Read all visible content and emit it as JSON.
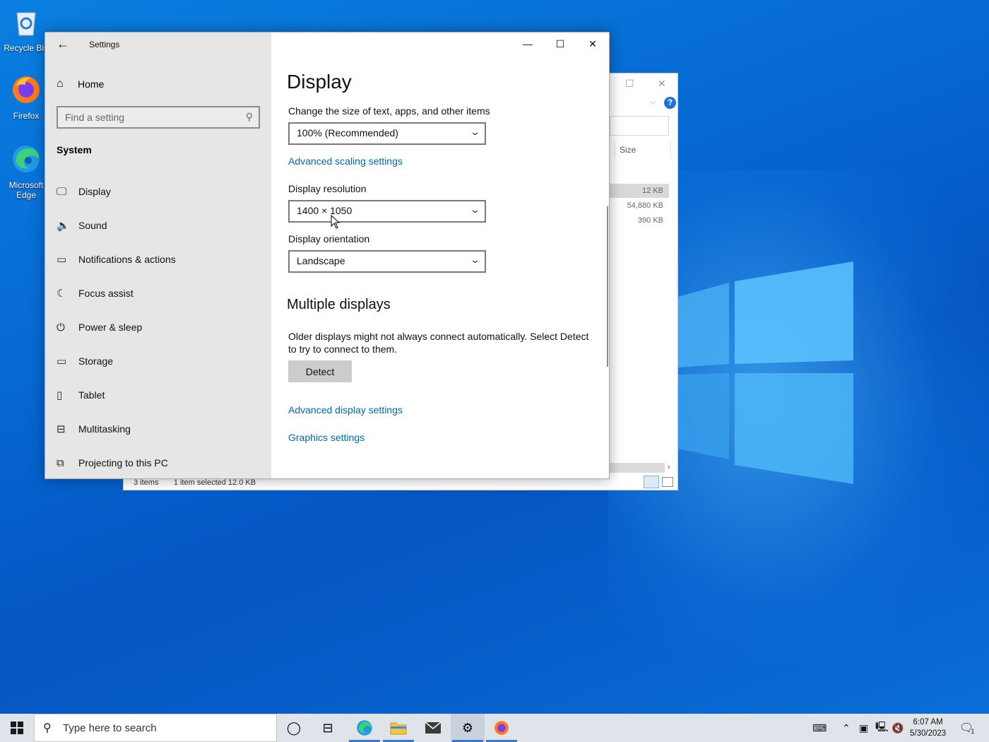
{
  "desktop": {
    "icons": [
      {
        "label": "Recycle Bin"
      },
      {
        "label": "Firefox"
      },
      {
        "label": "Microsoft Edge"
      }
    ]
  },
  "explorer": {
    "column_size": "Size",
    "rows": [
      "12 KB",
      "54,880 KB",
      "390 KB"
    ],
    "status_items": "3 items",
    "status_selected": "1 item selected  12.0 KB",
    "help": "?"
  },
  "settings": {
    "title": "Settings",
    "home_label": "Home",
    "search_placeholder": "Find a setting",
    "section_title": "System",
    "nav": [
      {
        "label": "Display",
        "icon": "monitor-icon"
      },
      {
        "label": "Sound",
        "icon": "speaker-icon"
      },
      {
        "label": "Notifications & actions",
        "icon": "notification-icon"
      },
      {
        "label": "Focus assist",
        "icon": "moon-icon"
      },
      {
        "label": "Power & sleep",
        "icon": "power-icon"
      },
      {
        "label": "Storage",
        "icon": "storage-icon"
      },
      {
        "label": "Tablet",
        "icon": "tablet-icon"
      },
      {
        "label": "Multitasking",
        "icon": "multitasking-icon"
      },
      {
        "label": "Projecting to this PC",
        "icon": "projecting-icon"
      }
    ],
    "page": {
      "heading": "Display",
      "scale_label": "Change the size of text, apps, and other items",
      "scale_value": "100% (Recommended)",
      "advanced_scaling": "Advanced scaling settings",
      "resolution_label": "Display resolution",
      "resolution_value": "1400 × 1050",
      "orientation_label": "Display orientation",
      "orientation_value": "Landscape",
      "multi_heading": "Multiple displays",
      "multi_text": "Older displays might not always connect automatically. Select Detect to try to connect to them.",
      "detect_label": "Detect",
      "advanced_display": "Advanced display settings",
      "graphics": "Graphics settings"
    }
  },
  "taskbar": {
    "search_placeholder": "Type here to search",
    "time": "6:07 AM",
    "date": "5/30/2023",
    "notification_count": "1"
  },
  "colors": {
    "accent_link": "#0067b8",
    "taskbar": "#dfe4ea"
  }
}
